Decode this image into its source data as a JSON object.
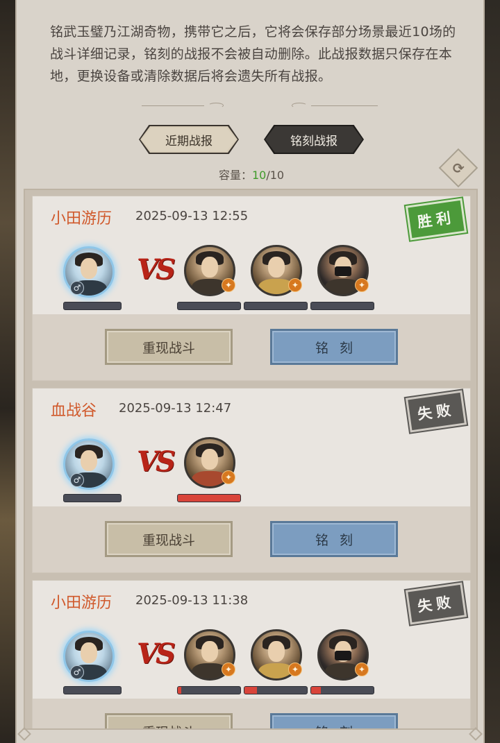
{
  "description": "铭武玉璧乃江湖奇物，携带它之后，它将会保存部分场景最近10场的战斗详细记录，铭刻的战报不会被自动删除。此战报数据只保存在本地，更换设备或清除数据后将会遗失所有战报。",
  "tabs": {
    "recent": "近期战报",
    "engraved": "铭刻战报"
  },
  "capacity": {
    "label": "容量：",
    "current": "10",
    "separator": "/",
    "max": "10"
  },
  "refresh_icon": "refresh-icon",
  "battles": [
    {
      "location": "小田游历",
      "time": "2025-09-13 12:55",
      "result": "胜利",
      "result_type": "win",
      "vs_label": "VS",
      "replay_label": "重现战斗",
      "engrave_label": "铭刻",
      "enemy_hp": [
        0,
        0,
        0
      ]
    },
    {
      "location": "血战谷",
      "time": "2025-09-13 12:47",
      "result": "失败",
      "result_type": "lose",
      "vs_label": "VS",
      "replay_label": "重现战斗",
      "engrave_label": "铭刻",
      "enemy_hp": [
        1.0
      ]
    },
    {
      "location": "小田游历",
      "time": "2025-09-13 11:38",
      "result": "失败",
      "result_type": "lose",
      "vs_label": "VS",
      "replay_label": "重现战斗",
      "engrave_label": "铭刻",
      "enemy_hp": [
        0.06,
        0.2,
        0.15
      ]
    }
  ],
  "colors": {
    "location": "#d0582a",
    "win_badge": "#4c9a3a",
    "lose_badge": "#5a5855",
    "vs": "#b82418",
    "capacity_current": "#3f9a2a",
    "engrave_button": "#7c9dc0",
    "replay_button": "#c8bea7"
  }
}
